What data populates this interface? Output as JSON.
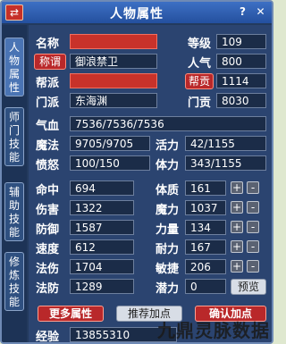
{
  "window": {
    "title": "人物属性",
    "left_button": "⇄",
    "help": "?",
    "close": "✕"
  },
  "tabs": [
    "人物属性",
    "师门技能",
    "辅助技能",
    "修炼技能"
  ],
  "basic": {
    "name_label": "名称",
    "name_value": "",
    "level_label": "等级",
    "level_value": "109",
    "title_label": "称谓",
    "title_value": "御浪禁卫",
    "popularity_label": "人气",
    "popularity_value": "800",
    "faction_label": "帮派",
    "faction_value": "",
    "contribution_label": "帮贡",
    "contribution_value": "1114",
    "sect_label": "门派",
    "sect_value": "东海渊",
    "sect_contrib_label": "门贡",
    "sect_contrib_value": "8030"
  },
  "vitals": [
    {
      "label": "气血",
      "value": "7536/7536/7536"
    },
    {
      "label": "魔法",
      "value": "9705/9705"
    },
    {
      "label": "愤怒",
      "value": "100/150"
    }
  ],
  "vitals_right": [
    {
      "label": "活力",
      "value": "42/1155"
    },
    {
      "label": "体力",
      "value": "343/1155"
    }
  ],
  "combat": [
    {
      "label": "命中",
      "value": "694"
    },
    {
      "label": "伤害",
      "value": "1322"
    },
    {
      "label": "防御",
      "value": "1587"
    },
    {
      "label": "速度",
      "value": "612"
    },
    {
      "label": "法伤",
      "value": "1704"
    },
    {
      "label": "法防",
      "value": "1289"
    }
  ],
  "attrs": [
    {
      "label": "体质",
      "value": "161"
    },
    {
      "label": "魔力",
      "value": "1037"
    },
    {
      "label": "力量",
      "value": "134"
    },
    {
      "label": "耐力",
      "value": "167"
    },
    {
      "label": "敏捷",
      "value": "206"
    },
    {
      "label": "潜力",
      "value": "0"
    }
  ],
  "plus": "+",
  "minus": "-",
  "buttons": {
    "preview": "预览",
    "more": "更多属性",
    "recommend": "推荐加点",
    "confirm": "确认加点"
  },
  "exp": {
    "label": "经验",
    "value": "13855310"
  },
  "watermark": "九鼎灵脉数据",
  "colors": {
    "panel_bg": "#2b4470",
    "accent_red": "#b9282a",
    "title_blue": "#3d70c4"
  }
}
